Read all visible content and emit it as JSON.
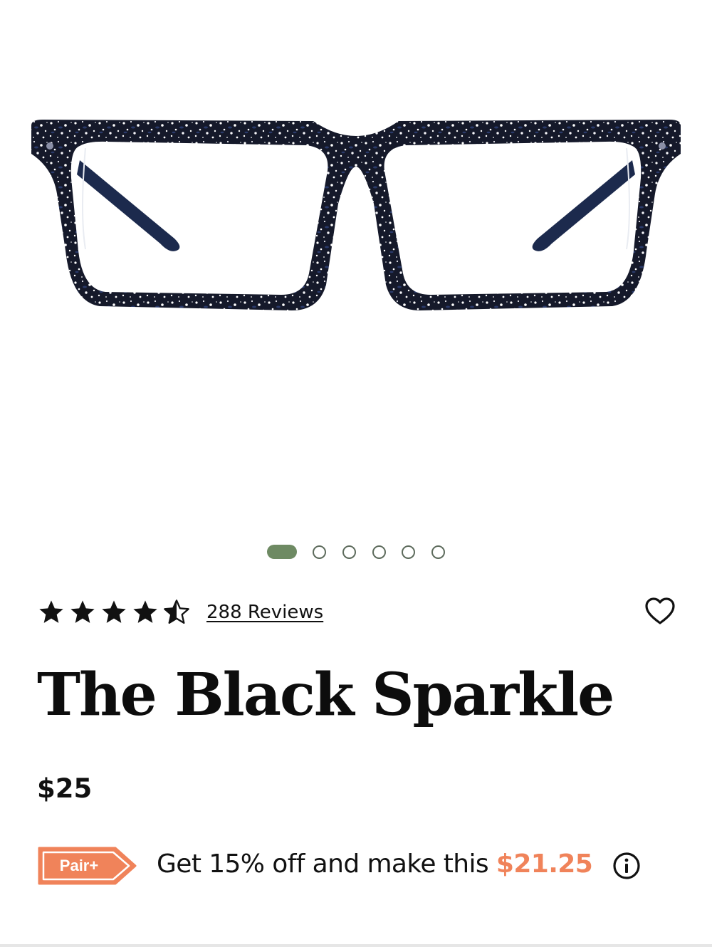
{
  "product": {
    "title": "The Black Sparkle",
    "price": "$25",
    "rating": 4.5,
    "rating_max": 5,
    "reviews_label": "288 Reviews"
  },
  "carousel": {
    "slide_count": 6,
    "active_index": 0,
    "active_color": "#6e8a63"
  },
  "promo": {
    "badge_label": "Pair+",
    "badge_color": "#f0835a",
    "text_prefix": "Get 15% off and make this ",
    "discount_price": "$21.25",
    "discount_color": "#f0835a"
  },
  "icons": {
    "favorite": "heart-outline-icon",
    "info": "info-circle-icon",
    "rating": "star-icon"
  },
  "image": {
    "subject": "glasses-frame",
    "frame_color": "#15192a",
    "speckle_color": "#ffffff",
    "accent_color": "#2a3a6a"
  }
}
